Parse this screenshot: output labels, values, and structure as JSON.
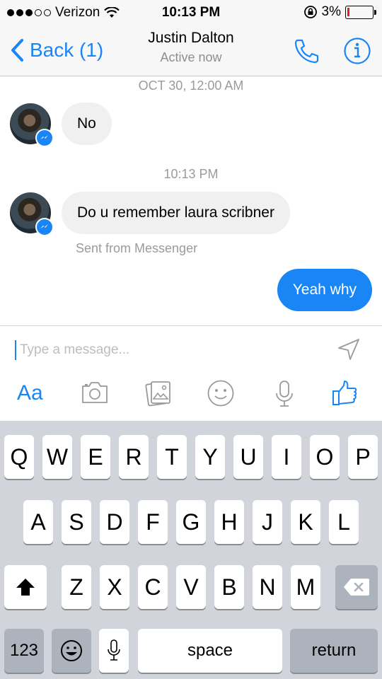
{
  "status_bar": {
    "carrier": "Verizon",
    "time": "10:13 PM",
    "battery": "3%"
  },
  "nav": {
    "back_label": "Back (1)",
    "contact_name": "Justin Dalton",
    "contact_status": "Active now"
  },
  "chat": {
    "timestamp_1": "OCT 30, 12:00 AM",
    "message_1": "No",
    "timestamp_2": "10:13 PM",
    "message_2": "Do u remember laura scribner",
    "sent_note": "Sent from Messenger",
    "message_3": "Yeah why"
  },
  "composer": {
    "placeholder": "Type a message...",
    "aa_label": "Aa"
  },
  "keyboard": {
    "row1": [
      "Q",
      "W",
      "E",
      "R",
      "T",
      "Y",
      "U",
      "I",
      "O",
      "P"
    ],
    "row2": [
      "A",
      "S",
      "D",
      "F",
      "G",
      "H",
      "J",
      "K",
      "L"
    ],
    "row3": [
      "Z",
      "X",
      "C",
      "V",
      "B",
      "N",
      "M"
    ],
    "numbers_label": "123",
    "space_label": "space",
    "return_label": "return"
  },
  "colors": {
    "accent": "#1a86f5",
    "incoming_bubble": "#f0f0f0",
    "keyboard_bg": "#d1d5db"
  }
}
